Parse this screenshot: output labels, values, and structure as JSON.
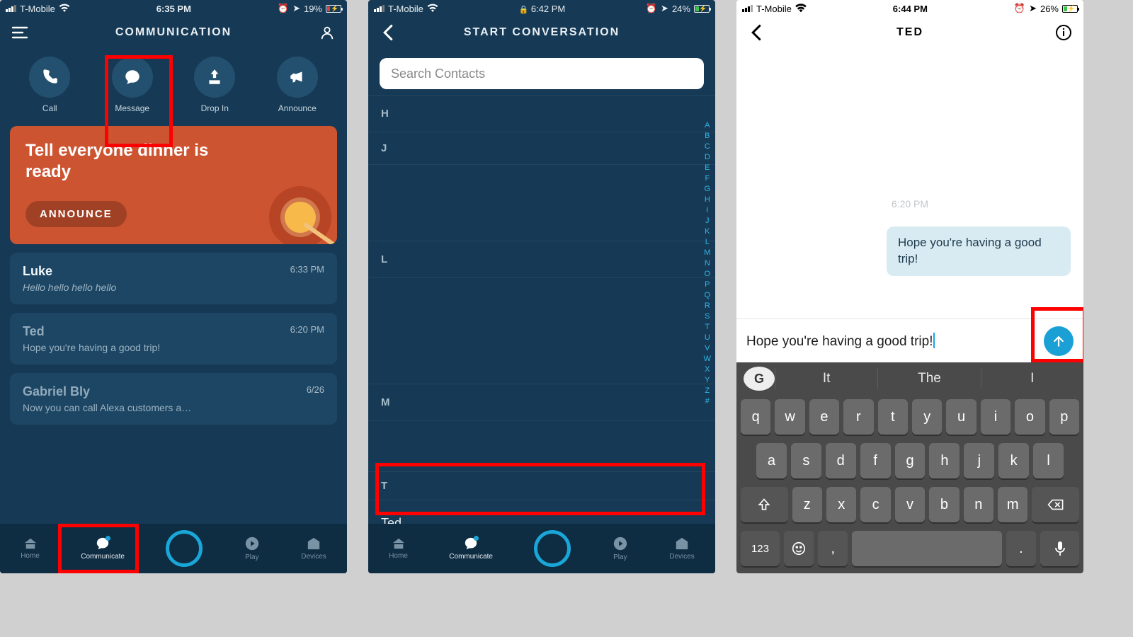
{
  "screen1": {
    "status": {
      "carrier": "T-Mobile",
      "time": "6:35 PM",
      "battery": "19%",
      "battColor": "#e04040",
      "battPct": 19
    },
    "title": "COMMUNICATION",
    "actions": [
      {
        "label": "Call",
        "icon": "phone-icon"
      },
      {
        "label": "Message",
        "icon": "message-icon"
      },
      {
        "label": "Drop In",
        "icon": "dropin-icon"
      },
      {
        "label": "Announce",
        "icon": "announce-icon"
      }
    ],
    "announceCard": {
      "headline": "Tell everyone dinner is ready",
      "button": "ANNOUNCE"
    },
    "conversations": [
      {
        "name": "Luke",
        "preview": "Hello hello hello hello",
        "time": "6:33 PM"
      },
      {
        "name": "Ted",
        "preview": "Hope you're having a good trip!",
        "time": "6:20 PM"
      },
      {
        "name": "Gabriel Bly",
        "preview": "Now you can call Alexa customers a…",
        "time": "6/26"
      }
    ],
    "tabs": [
      "Home",
      "Communicate",
      "",
      "Play",
      "Devices"
    ]
  },
  "screen2": {
    "status": {
      "carrier": "T-Mobile",
      "time": "6:42 PM",
      "battery": "24%",
      "battColor": "#41c351",
      "battPct": 24
    },
    "title": "START CONVERSATION",
    "searchPlaceholder": "Search Contacts",
    "sections": [
      "H",
      "J",
      "L",
      "M",
      "T"
    ],
    "contact": "Ted",
    "index": [
      "A",
      "B",
      "C",
      "D",
      "E",
      "F",
      "G",
      "H",
      "I",
      "J",
      "K",
      "L",
      "M",
      "N",
      "O",
      "P",
      "Q",
      "R",
      "S",
      "T",
      "U",
      "V",
      "W",
      "X",
      "Y",
      "Z",
      "#"
    ],
    "tabs": [
      "Home",
      "Communicate",
      "",
      "Play",
      "Devices"
    ]
  },
  "screen3": {
    "status": {
      "carrier": "T-Mobile",
      "time": "6:44 PM",
      "battery": "26%",
      "battColor": "#41c351",
      "battPct": 26
    },
    "title": "TED",
    "msgTime": "6:20 PM",
    "bubble": "Hope you're having a good trip!",
    "input": "Hope you're having a good trip!",
    "suggestions": [
      "It",
      "The",
      "I"
    ],
    "rows": {
      "r1": [
        "q",
        "w",
        "e",
        "r",
        "t",
        "y",
        "u",
        "i",
        "o",
        "p"
      ],
      "r2": [
        "a",
        "s",
        "d",
        "f",
        "g",
        "h",
        "j",
        "k",
        "l"
      ],
      "r3": [
        "z",
        "x",
        "c",
        "v",
        "b",
        "n",
        "m"
      ],
      "r4num": "123"
    }
  }
}
